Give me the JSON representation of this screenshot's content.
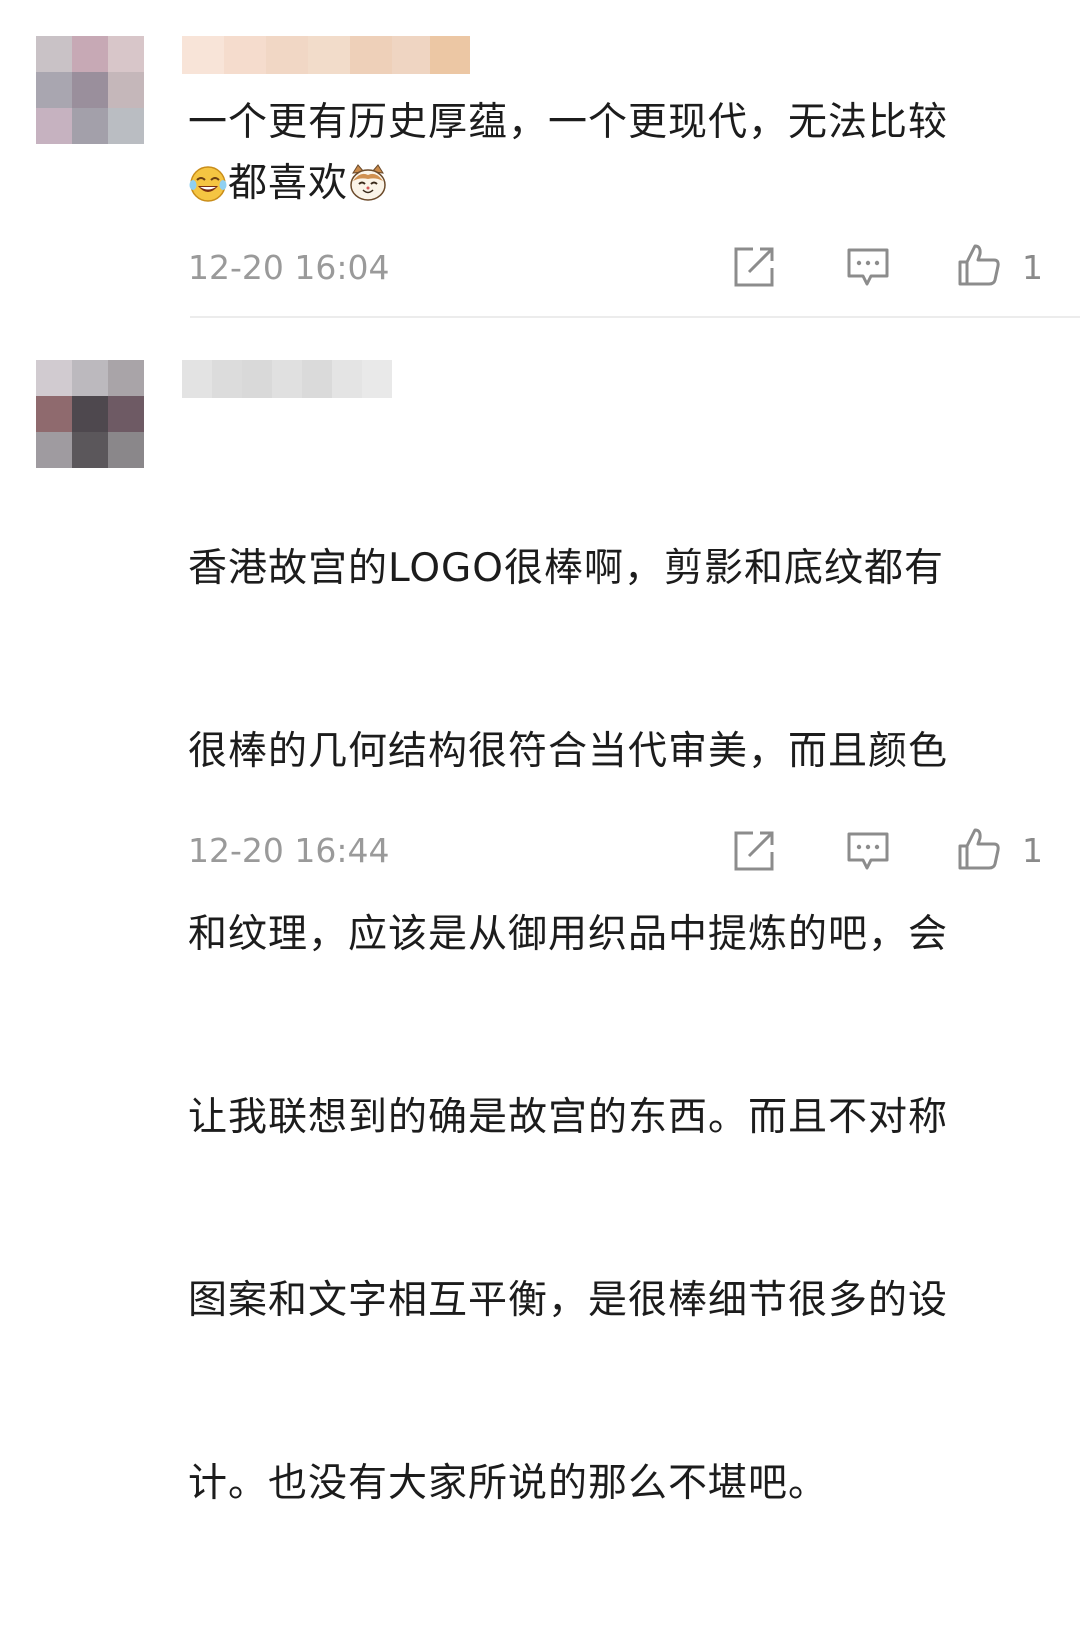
{
  "comments": [
    {
      "text_line1": "一个更有历史厚蕴，一个更现代，无法比较",
      "text_line2": "都喜欢",
      "emoji_before": "laughing-tears-emoji",
      "emoji_after": "cat-face-emoji",
      "timestamp": "12-20 16:04",
      "likes": "1",
      "colors": {
        "avatar": [
          "#c9c2c6",
          "#c7a9b5",
          "#d8c6c9",
          "#a9a6b0",
          "#9a8f9c",
          "#c5b7ba",
          "#c6b2c0",
          "#a3a0aa",
          "#babdc2"
        ],
        "name": [
          "#f8e4d8",
          "#f5dccd",
          "#f1d7c5",
          "#f2dcca",
          "#eed0b9",
          "#efd5c2",
          "#ecc7a4"
        ]
      }
    },
    {
      "text_lines": [
        "香港故宫的LOGO很棒啊，剪影和底纹都有",
        "很棒的几何结构很符合当代审美，而且颜色",
        "和纹理，应该是从御用织品中提炼的吧，会",
        "让我联想到的确是故宫的东西。而且不对称",
        "图案和文字相互平衡，是很棒细节很多的设",
        "计。也没有大家所说的那么不堪吧。"
      ],
      "timestamp": "12-20 16:44",
      "likes": "1",
      "colors": {
        "avatar": [
          "#d1cbd0",
          "#bcb9be",
          "#a9a4a8",
          "#8f6a6e",
          "#4e484e",
          "#6e5a64",
          "#9f9ba0",
          "#5b575b",
          "#8a878a"
        ],
        "name": [
          "#e3e3e3",
          "#dcdcdc",
          "#d9d9d9",
          "#e0e0e0",
          "#dadada",
          "#e4e4e4",
          "#e9e9e9"
        ]
      }
    }
  ],
  "icons": {
    "repost": "share-edit-icon",
    "reply": "comment-bubble-icon",
    "like": "thumbs-up-icon"
  }
}
